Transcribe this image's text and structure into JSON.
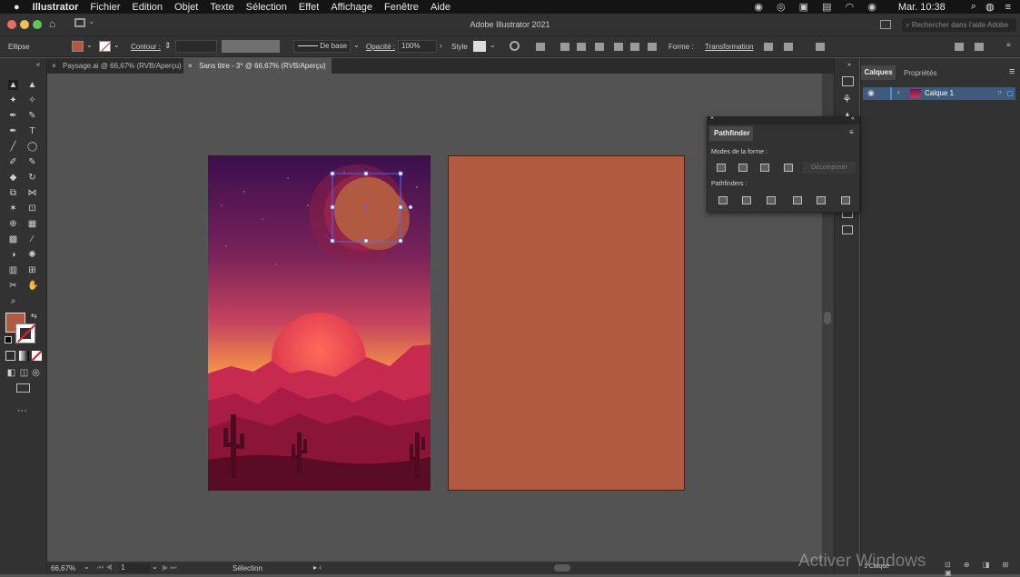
{
  "menubar": {
    "app": "Illustrator",
    "items": [
      "Fichier",
      "Edition",
      "Objet",
      "Texte",
      "Sélection",
      "Effet",
      "Affichage",
      "Fenêtre",
      "Aide"
    ],
    "clock": "Mar. 10:38"
  },
  "window": {
    "title": "Adobe Illustrator 2021",
    "help_placeholder": "Rechercher dans l'aide Adobe"
  },
  "control": {
    "object_type": "Ellipse",
    "stroke_label": "Contour :",
    "brush": "De base",
    "opacity_label": "Opacité :",
    "opacity": "100%",
    "style_label": "Style",
    "shape_label": "Forme :",
    "transform_label": "Transformation"
  },
  "tabs": [
    {
      "label": "Paysage.ai @ 66,67% (RVB/Aperçu)"
    },
    {
      "label": "Sans titre - 3* @ 66,67% (RVB/Aperçu)"
    }
  ],
  "status": {
    "zoom": "66,67%",
    "page": "1",
    "tool": "Sélection",
    "layers_count": "1 Calque"
  },
  "layers_panel": {
    "tabs": [
      "Calques",
      "Propriétés"
    ],
    "layer": "Calque 1"
  },
  "pathfinder": {
    "title": "Pathfinder",
    "shape_modes": "Modes de la forme :",
    "expand": "Décomposer",
    "pathfinders": "Pathfinders :"
  },
  "watermark": "Activer Windows",
  "colors": {
    "fill": "#b25a41",
    "accent": "#4a90e2"
  }
}
